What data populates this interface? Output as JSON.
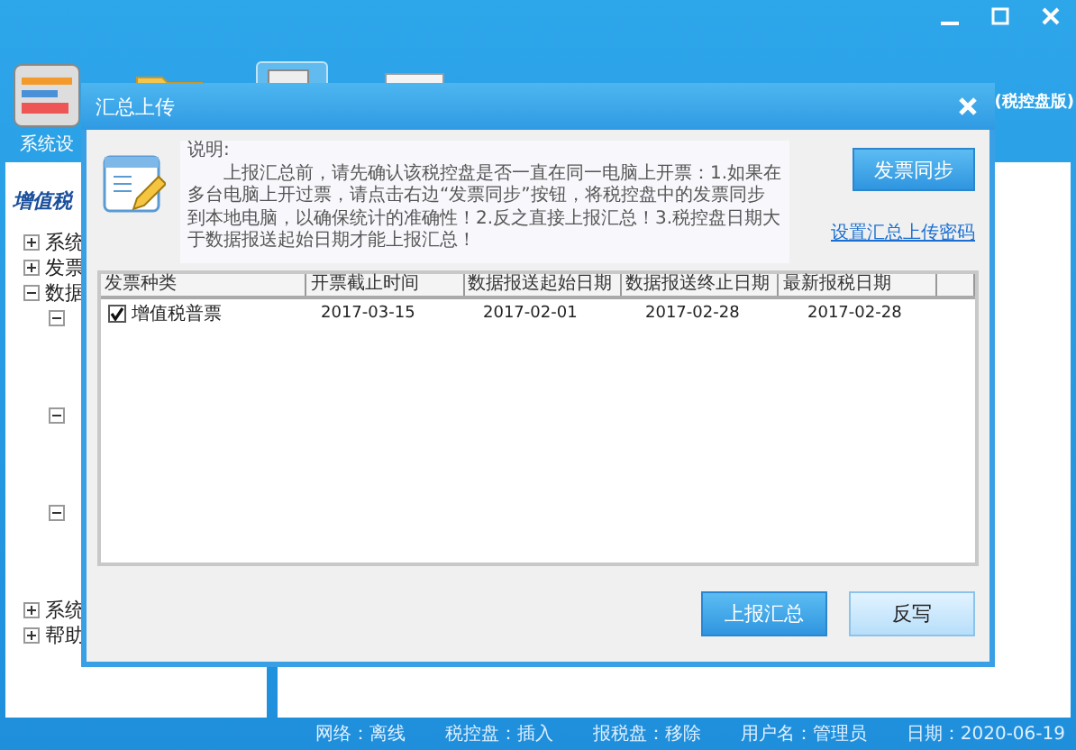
{
  "app": {
    "title_suffix": "(税控盘版)"
  },
  "toolbar": [
    {
      "kind": "settings",
      "label": "系统设",
      "selected": false
    },
    {
      "kind": "folder",
      "selected": false
    },
    {
      "kind": "search",
      "selected": true
    },
    {
      "kind": "document",
      "selected": false
    }
  ],
  "sidebar": {
    "title": "增值税",
    "tree": [
      {
        "label": "系统",
        "expanded": false
      },
      {
        "label": "发票",
        "expanded": false
      },
      {
        "label": "数据",
        "expanded": true,
        "children": [
          {
            "expanded": true
          },
          {
            "expanded": true
          },
          {
            "expanded": true
          }
        ]
      },
      {
        "label": "系统",
        "expanded": false
      },
      {
        "label": "帮助",
        "expanded": false
      }
    ]
  },
  "dialog": {
    "title": "汇总上传",
    "note_label": "说明:",
    "note": "上报汇总前，请先确认该税控盘是否一直在同一电脑上开票：1.如果在多台电脑上开过票，请点击右边“发票同步”按钮，将税控盘中的发票同步到本地电脑，以确保统计的准确性！2.反之直接上报汇总！3.税控盘日期大于数据报送起始日期才能上报汇总！",
    "sync_button": "发票同步",
    "password_link": "设置汇总上传密码",
    "table": {
      "columns": [
        "发票种类",
        "开票截止时间",
        "数据报送起始日期",
        "数据报送终止日期",
        "最新报税日期"
      ],
      "rows": [
        {
          "checked": true,
          "cells": [
            "增值税普票",
            "2017-03-15",
            "2017-02-01",
            "2017-02-28",
            "2017-02-28"
          ]
        }
      ]
    },
    "buttons": [
      {
        "label": "上报汇总",
        "primary": true
      },
      {
        "label": "反写",
        "primary": false
      }
    ]
  },
  "status_bar": [
    "网络：离线",
    "税控盘：插入",
    "报税盘：移除",
    "用户名：管理员",
    "日期：2020-06-19"
  ]
}
